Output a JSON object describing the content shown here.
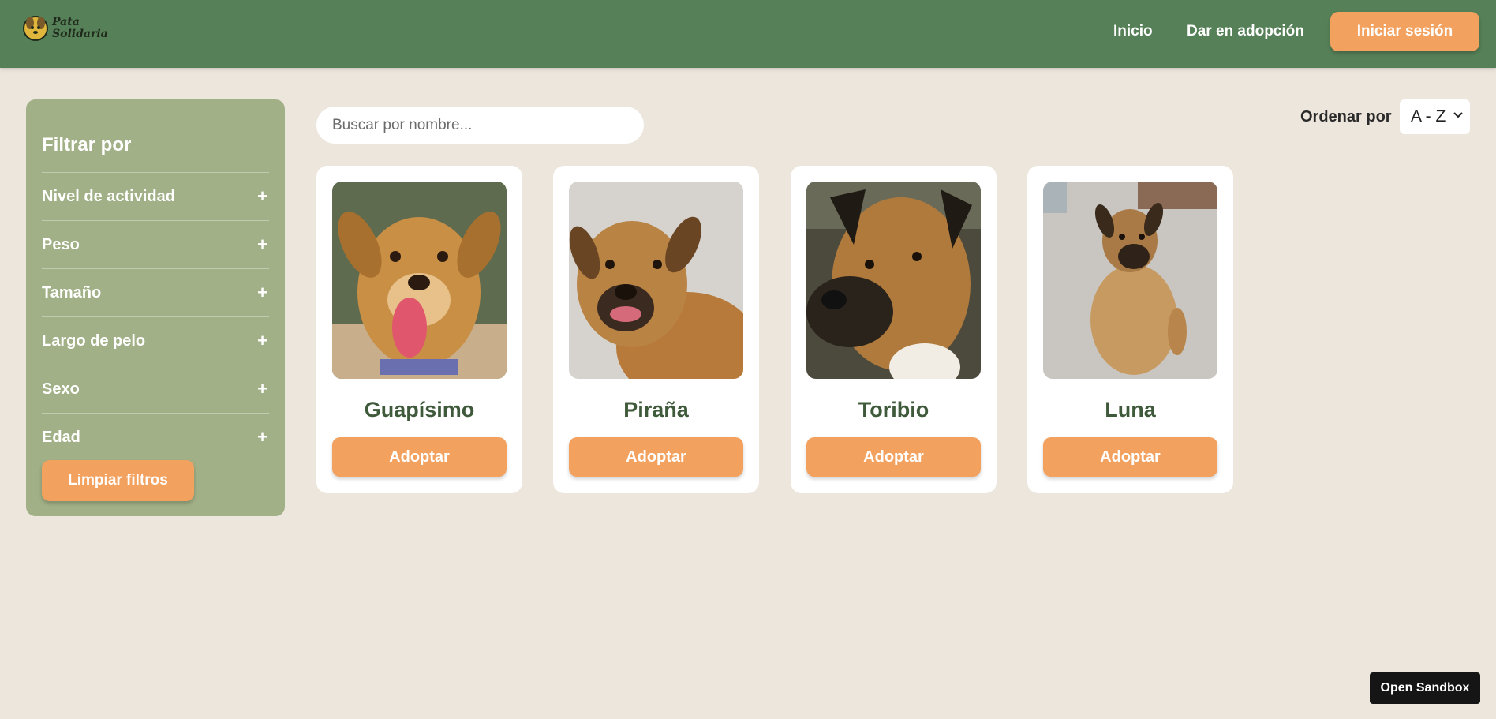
{
  "brand": {
    "name_line1": "Pata",
    "name_line2": "Solidaria"
  },
  "header": {
    "nav": [
      "Inicio",
      "Dar en adopción"
    ],
    "login_label": "Iniciar sesión"
  },
  "sidebar": {
    "title": "Filtrar por",
    "filters": [
      {
        "label": "Nivel de actividad",
        "toggle": "+"
      },
      {
        "label": "Peso",
        "toggle": "+"
      },
      {
        "label": "Tamaño",
        "toggle": "+"
      },
      {
        "label": "Largo de pelo",
        "toggle": "+"
      },
      {
        "label": "Sexo",
        "toggle": "+"
      },
      {
        "label": "Edad",
        "toggle": "+"
      }
    ],
    "clear_label": "Limpiar filtros"
  },
  "search": {
    "placeholder": "Buscar por nombre...",
    "value": ""
  },
  "sort": {
    "label": "Ordenar por",
    "selected": "A - Z"
  },
  "pets": [
    {
      "name": "Guapísimo",
      "button": "Adoptar"
    },
    {
      "name": "Piraña",
      "button": "Adoptar"
    },
    {
      "name": "Toribio",
      "button": "Adoptar"
    },
    {
      "name": "Luna",
      "button": "Adoptar"
    }
  ],
  "sandbox": {
    "label": "Open Sandbox"
  },
  "colors": {
    "header_bg": "#568057",
    "page_bg": "#ede6dc",
    "sidebar_bg": "#a1b086",
    "accent": "#f3a15f",
    "pet_name": "#3f5a3a"
  }
}
